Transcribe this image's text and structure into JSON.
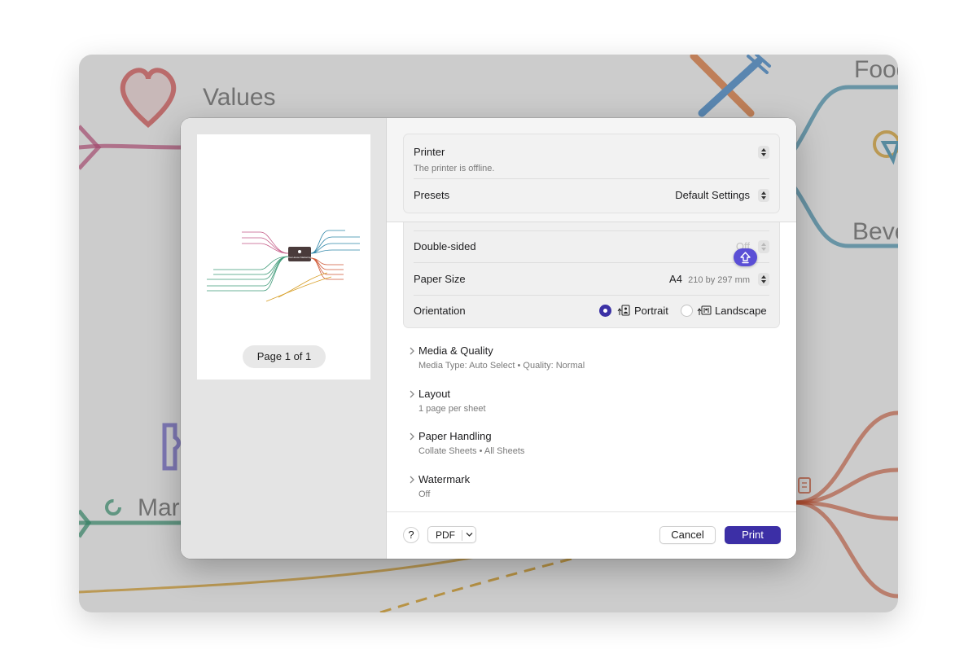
{
  "background_canvas": {
    "labels": {
      "values": "Values",
      "food": "Food",
      "beverages": "Beve",
      "marketing": "Mar"
    },
    "icons": [
      "heart-icon",
      "fork-knife-icon",
      "cone-icon",
      "memo-icon",
      "spinner-icon",
      "bottle-icon"
    ]
  },
  "dialog": {
    "preview": {
      "page_indicator": "Page 1 of 1",
      "thumbnail_center": "Tea House Marketing"
    },
    "printer": {
      "label": "Printer",
      "status": "The printer is offline."
    },
    "presets": {
      "label": "Presets",
      "value": "Default Settings"
    },
    "double_sided": {
      "label": "Double-sided",
      "value": "Off"
    },
    "paper_size": {
      "label": "Paper Size",
      "value": "A4",
      "dimensions": "210 by 297 mm"
    },
    "orientation": {
      "label": "Orientation",
      "options": [
        "Portrait",
        "Landscape"
      ],
      "selected": "Portrait"
    },
    "sections": [
      {
        "title": "Media & Quality",
        "detail": "Media Type: Auto Select • Quality: Normal"
      },
      {
        "title": "Layout",
        "detail": "1 page per sheet"
      },
      {
        "title": "Paper Handling",
        "detail": "Collate Sheets • All Sheets"
      },
      {
        "title": "Watermark",
        "detail": "Off"
      }
    ],
    "footer": {
      "help": "?",
      "pdf": "PDF",
      "cancel": "Cancel",
      "print": "Print"
    }
  },
  "colors": {
    "accent": "#3c2fa6",
    "badge": "#5b4fd6",
    "branch_pink": "#c45a86",
    "branch_blue": "#2f86a8",
    "branch_orange": "#d05a38",
    "branch_green": "#3f9a78",
    "branch_gold": "#d8a02a"
  }
}
